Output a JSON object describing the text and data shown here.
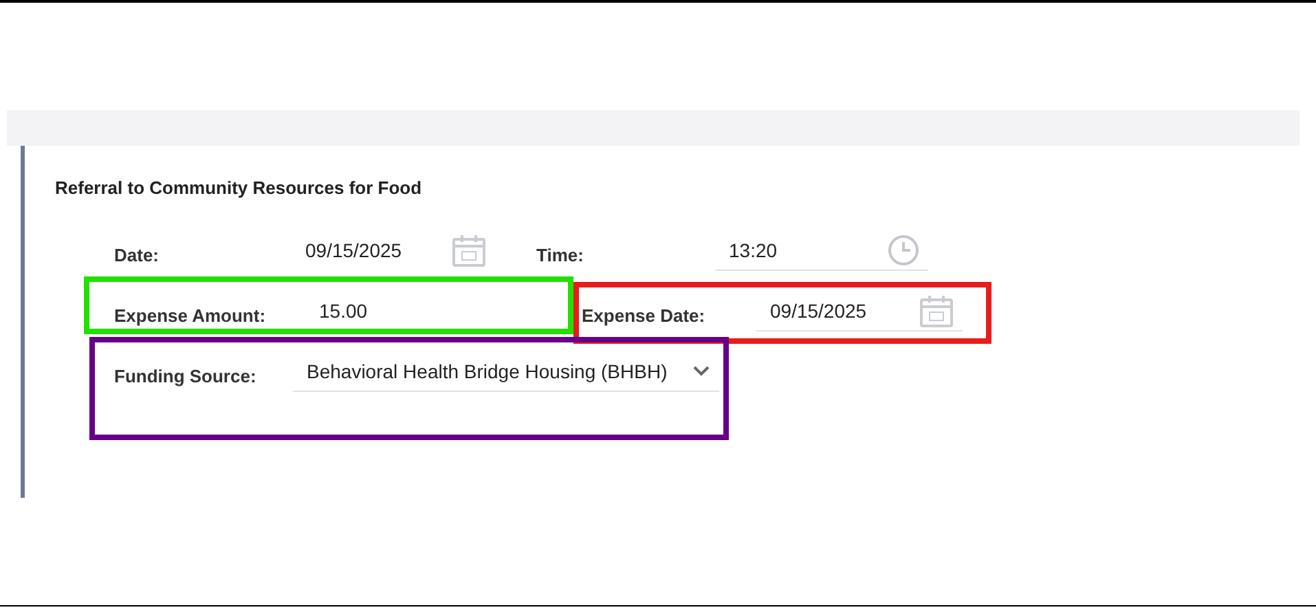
{
  "section": {
    "title": "Referral to Community Resources for Food"
  },
  "rows": [
    [
      {
        "label": "Date:",
        "value": "09/15/2025",
        "kind": "date"
      },
      {
        "label": "Time:",
        "value": "13:20",
        "kind": "time"
      }
    ],
    [
      {
        "label": "Expense Amount:",
        "value": "15.00",
        "kind": "text"
      },
      {
        "label": "Expense Date:",
        "value": "09/15/2025",
        "kind": "date"
      }
    ],
    [
      {
        "label": "Funding Source:",
        "value": "Behavioral Health Bridge Housing (BHBH)",
        "kind": "select"
      }
    ]
  ],
  "annotations": [
    {
      "color": "#22e000"
    },
    {
      "color": "#e81c1c"
    },
    {
      "color": "#660088"
    }
  ]
}
